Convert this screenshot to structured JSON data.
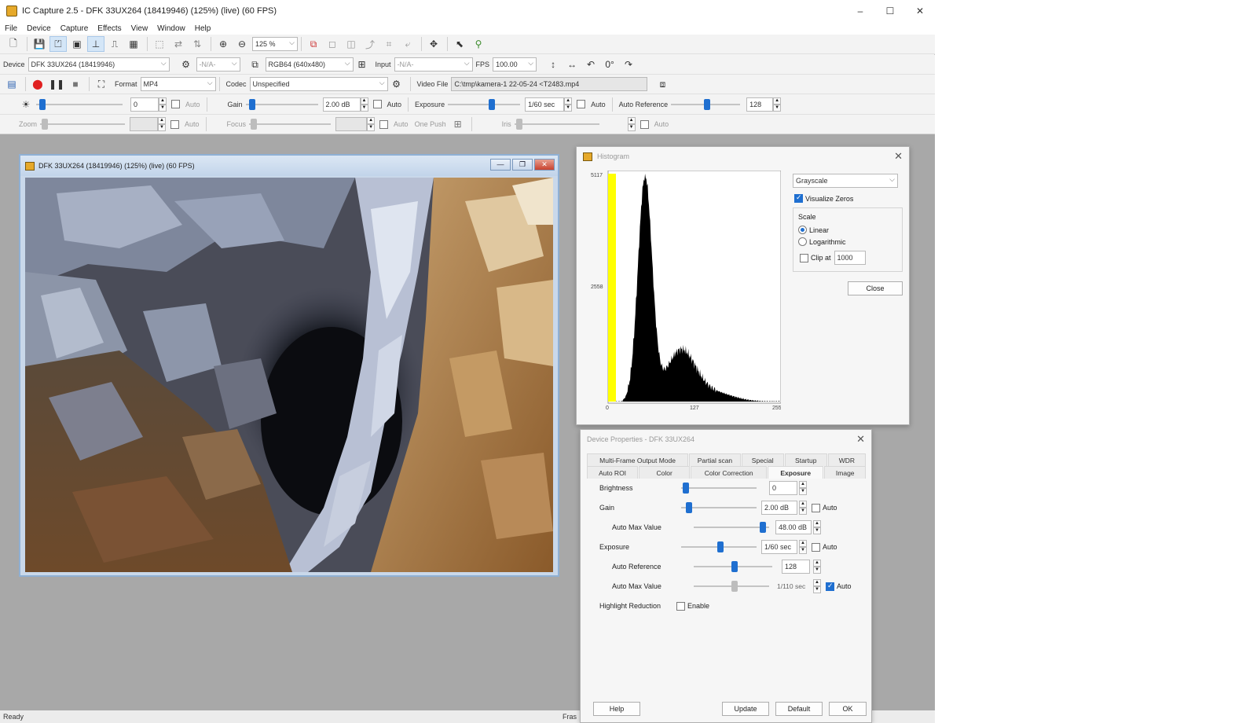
{
  "window": {
    "title": "IC Capture 2.5 - DFK 33UX264 (18419946) (125%) (live) (60 FPS)",
    "controls": [
      "–",
      "☐",
      "✕"
    ]
  },
  "menu": [
    "File",
    "Device",
    "Capture",
    "Effects",
    "View",
    "Window",
    "Help"
  ],
  "toolbar": {
    "zoom": "125 %"
  },
  "device_bar": {
    "device_label": "Device",
    "device_value": "DFK 33UX264 (18419946)",
    "na1": "-N/A-",
    "format_value": "RGB64 (640x480)",
    "input_label": "Input",
    "input_value": "-N/A-",
    "fps_label": "FPS",
    "fps_value": "100.00"
  },
  "capture_bar": {
    "format_label": "Format",
    "format_value": "MP4",
    "codec_label": "Codec",
    "codec_value": "Unspecified",
    "videofile_label": "Video File",
    "videofile_value": "C:\\tmp\\kamera-1 22-05-24 <T2483.mp4"
  },
  "props_bar1": {
    "brightness_value": "0",
    "auto": "Auto",
    "gain_label": "Gain",
    "gain_value": "2.00 dB",
    "exposure_label": "Exposure",
    "exposure_value": "1/60 sec",
    "auto_ref_label": "Auto Reference",
    "auto_ref_value": "128"
  },
  "props_bar2": {
    "zoom_label": "Zoom",
    "auto": "Auto",
    "focus_label": "Focus",
    "onepush_label": "One Push",
    "iris_label": "Iris"
  },
  "live_window": {
    "title": "DFK 33UX264 (18419946) (125%) (live) (60 FPS)"
  },
  "histogram": {
    "title": "Histogram",
    "y_top": "5117",
    "y_mid": "2558",
    "x_ticks": [
      "0",
      "127",
      "255"
    ],
    "mode": "Grayscale",
    "visualize_zeros": "Visualize Zeros",
    "scale_label": "Scale",
    "linear": "Linear",
    "logarithmic": "Logarithmic",
    "clip_label": "Clip at",
    "clip_value": "1000",
    "close": "Close"
  },
  "device_props": {
    "title": "Device Properties - DFK 33UX264",
    "tabs_row1": [
      "Multi-Frame Output Mode",
      "Partial scan",
      "Special",
      "Startup",
      "WDR"
    ],
    "tabs_row2": [
      "Auto ROI",
      "Color",
      "Color Correction",
      "Exposure",
      "Image"
    ],
    "rows": {
      "brightness": {
        "label": "Brightness",
        "value": "0"
      },
      "gain": {
        "label": "Gain",
        "value": "2.00 dB",
        "auto": "Auto"
      },
      "gain_max": {
        "label": "Auto Max Value",
        "value": "48.00 dB"
      },
      "exposure": {
        "label": "Exposure",
        "value": "1/60 sec",
        "auto": "Auto"
      },
      "exp_ref": {
        "label": "Auto Reference",
        "value": "128"
      },
      "exp_max": {
        "label": "Auto Max Value",
        "value": "1/110 sec",
        "auto": "Auto"
      },
      "highlight": {
        "label": "Highlight Reduction",
        "enable": "Enable"
      }
    },
    "buttons": {
      "help": "Help",
      "update": "Update",
      "default": "Default",
      "ok": "OK"
    }
  },
  "status": {
    "ready": "Ready",
    "fps": "Fras"
  },
  "histogram_data": {
    "peak_bin": 45,
    "peak_normalized": 0.98,
    "secondary_bin": 100,
    "secondary_normalized": 0.22
  }
}
